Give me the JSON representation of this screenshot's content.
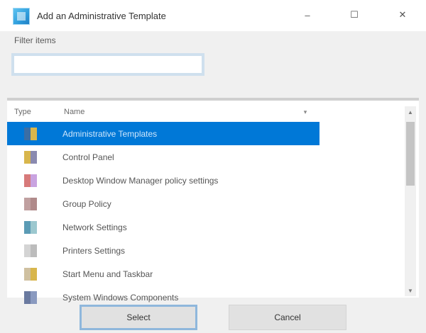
{
  "window": {
    "title": "Add an Administrative Template",
    "buttons": {
      "minimize": "–",
      "maximize": "☐",
      "close": "✕"
    }
  },
  "search": {
    "label": "Filter items",
    "value": "",
    "placeholder": ""
  },
  "list": {
    "columns": {
      "type": "Type",
      "name": "Name",
      "sort_indicator": "▾"
    },
    "selected_index": 0,
    "rows": [
      {
        "name": "Administrative Templates",
        "icon": "template-icon",
        "colors": [
          "#3a6ea5",
          "#d8b64c"
        ]
      },
      {
        "name": "Control Panel",
        "icon": "folder-icon",
        "colors": [
          "#d8b64c",
          "#8a8ab0"
        ]
      },
      {
        "name": "Desktop Window Manager policy settings",
        "icon": "settings-icon",
        "colors": [
          "#d77a7a",
          "#c9a3e0"
        ]
      },
      {
        "name": "Group Policy",
        "icon": "folder-icon",
        "colors": [
          "#c0a0a0",
          "#b08a8a"
        ]
      },
      {
        "name": "Network Settings",
        "icon": "network-icon",
        "colors": [
          "#5b9bb5",
          "#9cc8cf"
        ]
      },
      {
        "name": "Printers Settings",
        "icon": "printer-icon",
        "colors": [
          "#d4d4d4",
          "#bcbcbc"
        ]
      },
      {
        "name": "Start Menu and Taskbar",
        "icon": "folder-icon",
        "colors": [
          "#cfc0a0",
          "#d8b64c"
        ]
      },
      {
        "name": "System Windows Components",
        "icon": "system-icon",
        "colors": [
          "#6a7aa0",
          "#8a9ac0"
        ]
      }
    ]
  },
  "footer": {
    "select_label": "Select",
    "cancel_label": "Cancel"
  }
}
